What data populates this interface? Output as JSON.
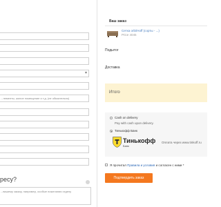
{
  "checkout_form": {
    "address_hint": "...лементы, жилое помещение и т.д. (не обязательно)",
    "section_heading": "ресу?",
    "comment_placeholder": "...вашему заказу, например, особые пожелания отделу"
  },
  "order": {
    "title": "Ваш заказ",
    "product_name": "Сетка orbi/Hoff (сорты - ...)",
    "product_price": "Price 4045",
    "subtotal_label": "Подытог",
    "shipping_label": "Доставка",
    "total_label": "Итого"
  },
  "payment": {
    "cod_title": "Cash on delivery",
    "cod_desc": "Pay with cash upon delivery.",
    "tinkoff_title": "Тинькофф Банк",
    "tinkoff_brand": "Тинькофф",
    "tinkoff_sub": "Банк",
    "tinkoff_desc": "Оплата через www.tinkoff.ru"
  },
  "terms": {
    "prefix": "Я прочитал ",
    "link": "Правила и условия",
    "suffix": " и согласен с ними *"
  },
  "confirm_button": "Подтвердить заказ",
  "colors": {
    "accent": "#f4781f",
    "link": "#2a67b6",
    "total_bg": "#fdf3d2"
  }
}
